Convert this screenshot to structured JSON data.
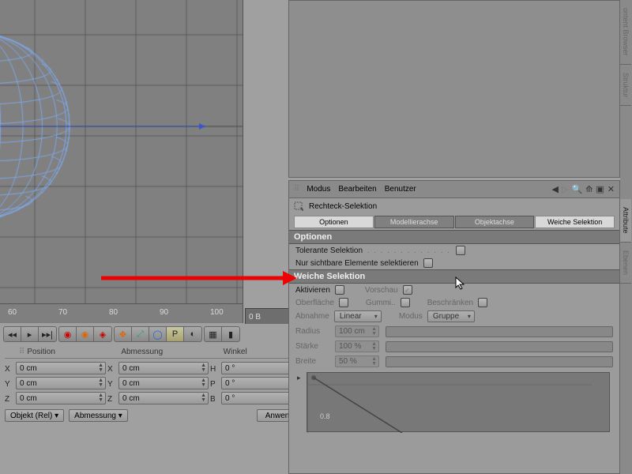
{
  "ruler": {
    "ticks": [
      "60",
      "70",
      "80",
      "90",
      "100"
    ]
  },
  "scrub": "0 B",
  "coords": {
    "headers": {
      "pos": "Position",
      "dim": "Abmessung",
      "angle": "Winkel"
    },
    "rows": [
      {
        "axis": "X",
        "pos": "0 cm",
        "dim_axis": "X",
        "dim": "0 cm",
        "ang_axis": "H",
        "angle": "0 °"
      },
      {
        "axis": "Y",
        "pos": "0 cm",
        "dim_axis": "Y",
        "dim": "0 cm",
        "ang_axis": "P",
        "angle": "0 °"
      },
      {
        "axis": "Z",
        "pos": "0 cm",
        "dim_axis": "Z",
        "dim": "0 cm",
        "ang_axis": "B",
        "angle": "0 °"
      }
    ],
    "mode": "Objekt (Rel)",
    "dim_combo": "Abmessung",
    "apply": "Anwenden"
  },
  "attr": {
    "menus": {
      "modus": "Modus",
      "bearbeiten": "Bearbeiten",
      "benutzer": "Benutzer"
    },
    "title": "Rechteck-Selektion",
    "tabs": {
      "optionen": "Optionen",
      "modellierachse": "Modellierachse",
      "objektachse": "Objektachse",
      "weiche": "Weiche Selektion"
    },
    "section1": "Optionen",
    "opt_tolerant": "Tolerante Selektion",
    "opt_visible": "Nur sichtbare Elemente selektieren",
    "section2": "Weiche Selektion",
    "ws": {
      "aktivieren": "Aktivieren",
      "vorschau": "Vorschau",
      "oberflaeche": "Oberfläche",
      "gummi": "Gummi..",
      "beschraenken": "Beschränken",
      "abnahme": "Abnahme",
      "abnahme_val": "Linear",
      "modus": "Modus",
      "modus_val": "Gruppe",
      "radius": "Radius",
      "radius_val": "100 cm",
      "staerke": "Stärke",
      "staerke_val": "100 %",
      "breite": "Breite",
      "breite_val": "50 %",
      "graph_tick": "0.8"
    }
  },
  "sidetabs": {
    "content": "ontent Browser",
    "struktur": "Struktur",
    "attribute": "Attribute",
    "ebenen": "Ebenen"
  }
}
